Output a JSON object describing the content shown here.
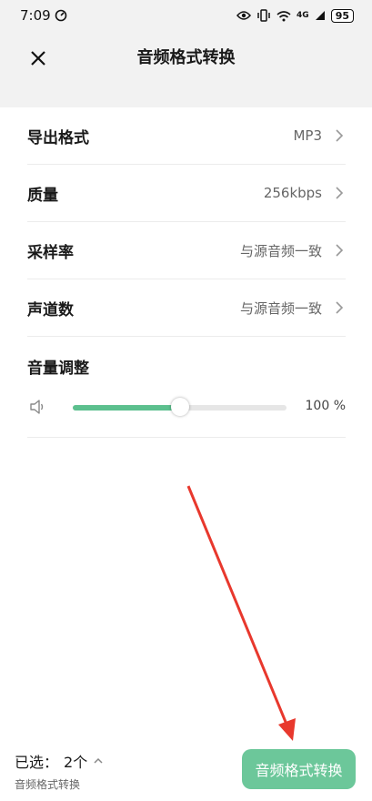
{
  "status_bar": {
    "time": "7:09",
    "battery": "95",
    "network": "4G"
  },
  "header": {
    "title": "音频格式转换"
  },
  "settings": [
    {
      "label": "导出格式",
      "value": "MP3"
    },
    {
      "label": "质量",
      "value": "256kbps"
    },
    {
      "label": "采样率",
      "value": "与源音频一致"
    },
    {
      "label": "声道数",
      "value": "与源音频一致"
    }
  ],
  "volume": {
    "label": "音量调整",
    "value_text": "100 %",
    "level": 0.5
  },
  "footer": {
    "selected_prefix": "已选：",
    "selected_count": "2个",
    "subtitle": "音频格式转换",
    "convert_button": "音频格式转换"
  },
  "colors": {
    "accent": "#5cc08e",
    "button": "#6cc79a",
    "arrow": "#e8382d"
  }
}
